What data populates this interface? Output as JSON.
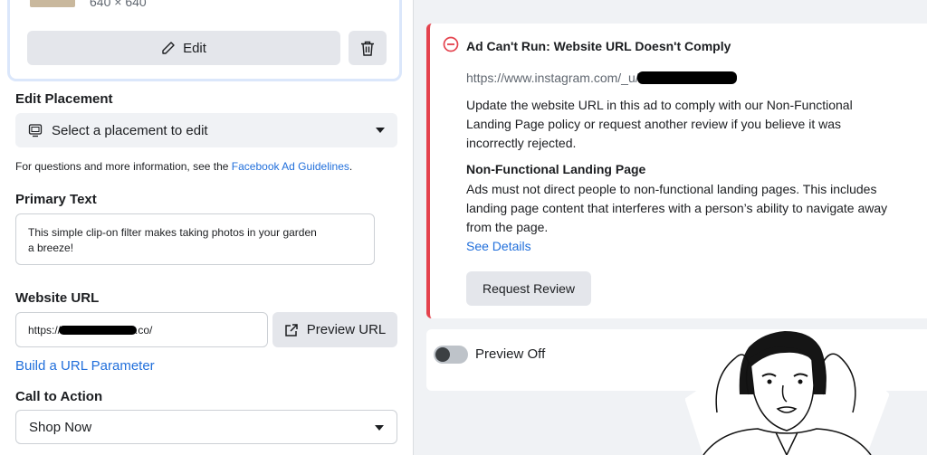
{
  "media": {
    "dimensions": "640 × 640",
    "edit_label": "Edit"
  },
  "placement": {
    "heading": "Edit Placement",
    "select_value": "Select a placement to edit"
  },
  "guidelines": {
    "prefix": "For questions and more information, see the ",
    "link": "Facebook Ad Guidelines",
    "suffix": "."
  },
  "primary_text": {
    "heading": "Primary Text",
    "line1": "This simple clip-on filter makes taking photos in your garden",
    "line2": "a breeze!"
  },
  "website_url": {
    "heading": "Website URL",
    "value_prefix": "https://",
    "value_suffix": ".co/",
    "preview_button": "Preview URL",
    "param_link": "Build a URL Parameter"
  },
  "cta": {
    "heading": "Call to Action",
    "select_value": "Shop Now"
  },
  "alert": {
    "title": "Ad Can't Run: Website URL Doesn't Comply",
    "url_prefix": "https://www.instagram.com/_u/",
    "message_line1": "Update the website URL in this ad to comply with our Non-Functional",
    "message_line2": "Landing Page policy or request another review if you believe it was",
    "message_line3": "incorrectly rejected.",
    "policy_title": "Non-Functional Landing Page",
    "policy_line1": "Ads must not direct people to non-functional landing pages. This includes",
    "policy_line2": "landing page content that interferes with a person’s ability to navigate away",
    "policy_line3": "from the page.",
    "details_link": "See Details",
    "review_button": "Request Review",
    "accent_color": "#e4424d"
  },
  "preview": {
    "label": "Preview Off",
    "enabled": false
  },
  "icons": [
    "pencil-icon",
    "trash-icon",
    "monitor-icon",
    "external-link-icon",
    "minus-circle-icon",
    "caret-down-icon"
  ]
}
